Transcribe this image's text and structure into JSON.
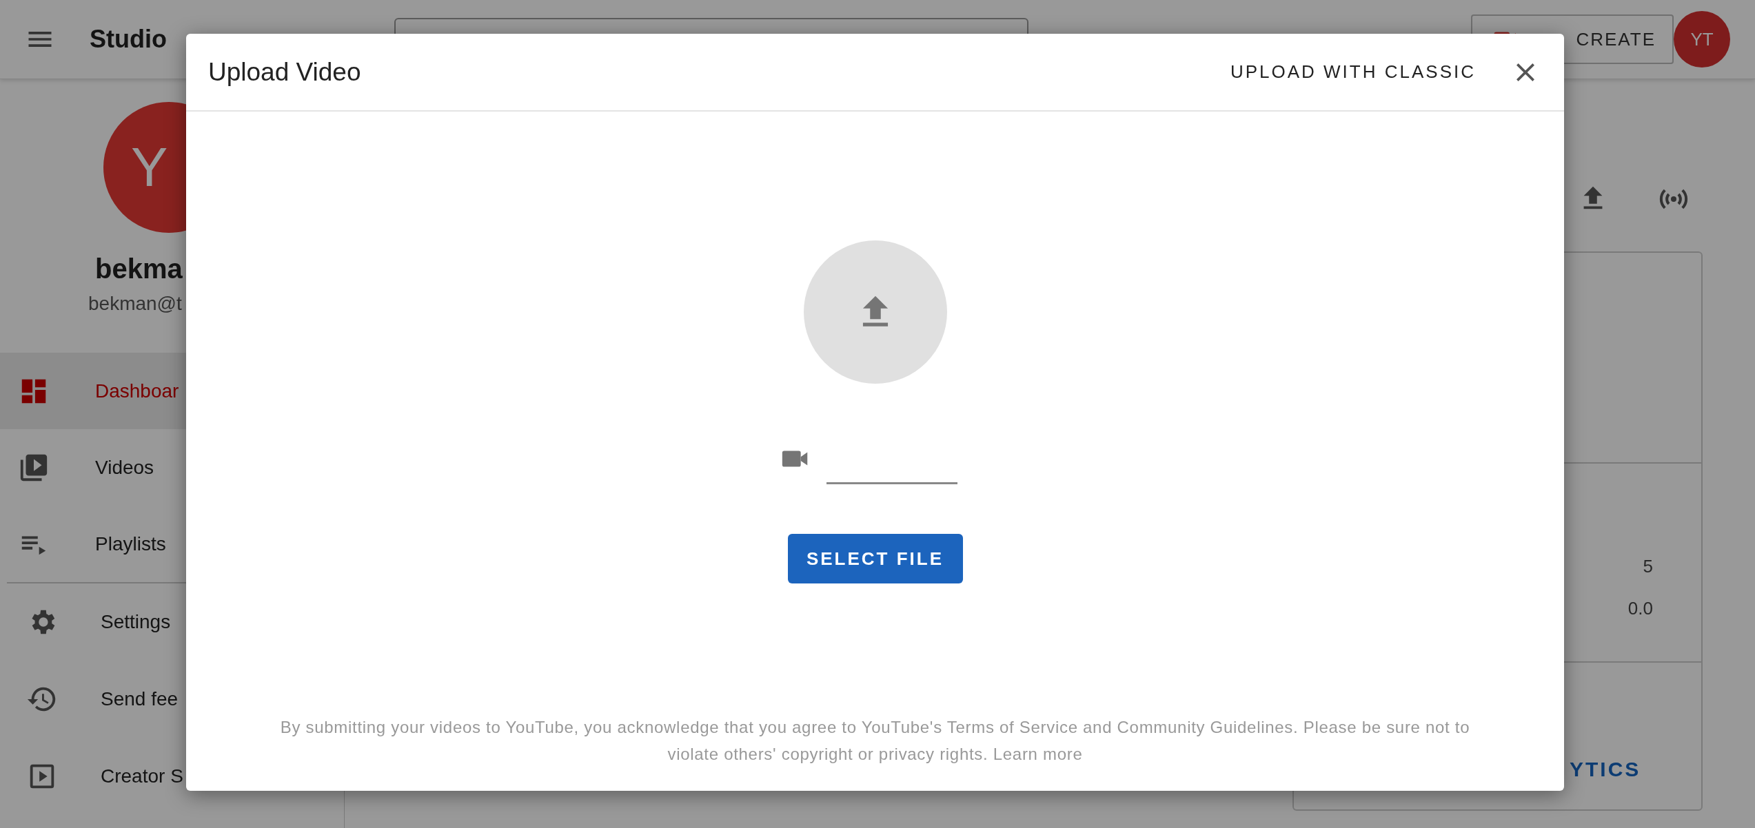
{
  "topbar": {
    "title": "Studio",
    "create_button": "CREATE",
    "avatar": "YT"
  },
  "sidebar": {
    "avatar": "Y",
    "name": "bekma",
    "email": "bekman@t",
    "items": [
      {
        "label": "Dashboar",
        "kind": "dashboard",
        "selected": true
      },
      {
        "label": "Videos",
        "kind": "videos",
        "selected": false
      },
      {
        "label": "Playlists",
        "kind": "playlists",
        "selected": false
      }
    ],
    "extra_items": [
      {
        "label": "Settings",
        "kind": "settings",
        "selected": false
      },
      {
        "label": "Send fee",
        "kind": "history",
        "selected": false
      },
      {
        "label": "Creator S",
        "kind": "play",
        "selected": false
      }
    ]
  },
  "dashboard": {
    "values": [
      "5",
      "0.0"
    ],
    "link": "YTICS"
  },
  "dialog": {
    "title": "Upload Video",
    "classic_button": "UPLOAD WITH CLASSIC",
    "select_button": "SELECT FILE",
    "notice": "By submitting your videos to YouTube, you acknowledge that you agree to YouTube's Terms of Service and Community Guidelines. Please be sure not to violate others' copyright or privacy rights.",
    "learn_more": "Learn more"
  }
}
